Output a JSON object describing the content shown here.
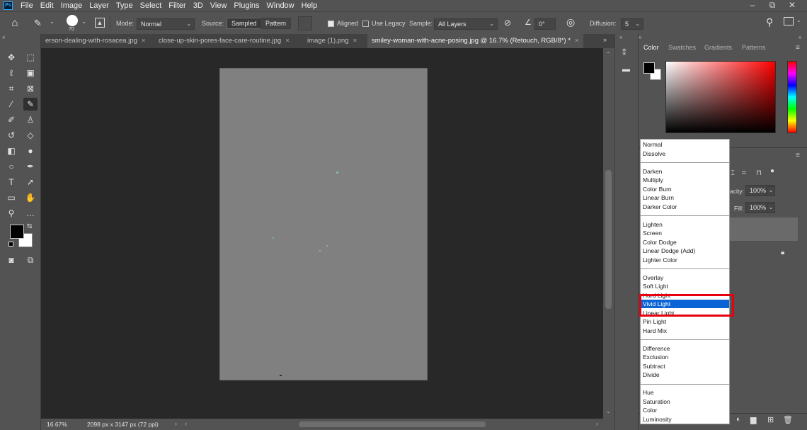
{
  "app": {
    "logo_text": "Ps",
    "menu": [
      "File",
      "Edit",
      "Image",
      "Layer",
      "Type",
      "Select",
      "Filter",
      "3D",
      "View",
      "Plugins",
      "Window",
      "Help"
    ],
    "window_controls": {
      "minimize": "–",
      "restore": "⧉",
      "close": "✕"
    }
  },
  "options": {
    "brush_size": "70",
    "mode_label": "Mode:",
    "mode_value": "Normal",
    "source_label": "Source:",
    "sampled": "Sampled",
    "pattern": "Pattern",
    "aligned": "Aligned",
    "use_legacy": "Use Legacy",
    "sample_label": "Sample:",
    "sample_value": "All Layers",
    "angle_value": "0°",
    "diffusion_label": "Diffusion:",
    "diffusion_value": "5"
  },
  "tabs": [
    {
      "label": "erson-dealing-with-rosacea.jpg",
      "active": false
    },
    {
      "label": "close-up-skin-pores-face-care-routine.jpg",
      "active": false
    },
    {
      "label": "image (1).png",
      "active": false
    },
    {
      "label": "smiley-woman-with-acne-posing.jpg @ 16.7% (Retouch, RGB/8*) *",
      "active": true
    }
  ],
  "tab_close": "×",
  "status": {
    "zoom": "16.67%",
    "doc_info": "2098 px x 3147 px (72 ppi)"
  },
  "panels": {
    "color_tabs": [
      "Color",
      "Swatches",
      "Gradients",
      "Patterns"
    ],
    "opacity_label": "acity:",
    "opacity_value": "100%",
    "fill_label": "Fill:",
    "fill_value": "100%"
  },
  "blend_modes": {
    "groups": [
      [
        "Normal",
        "Dissolve"
      ],
      [
        "Darken",
        "Multiply",
        "Color Burn",
        "Linear Burn",
        "Darker Color"
      ],
      [
        "Lighten",
        "Screen",
        "Color Dodge",
        "Linear Dodge (Add)",
        "Lighter Color"
      ],
      [
        "Overlay",
        "Soft Light",
        "Hard Light",
        "Vivid Light",
        "Linear Light",
        "Pin Light",
        "Hard Mix"
      ],
      [
        "Difference",
        "Exclusion",
        "Subtract",
        "Divide"
      ],
      [
        "Hue",
        "Saturation",
        "Color",
        "Luminosity"
      ]
    ],
    "selected": "Vivid Light",
    "annotation_color": "#e8000f"
  },
  "colors": {
    "ui_bg": "#535353",
    "canvas_bg": "#282828",
    "document_fill": "#808080",
    "foreground": "#000000",
    "background": "#ffffff",
    "highlight": "#0a64d6"
  }
}
